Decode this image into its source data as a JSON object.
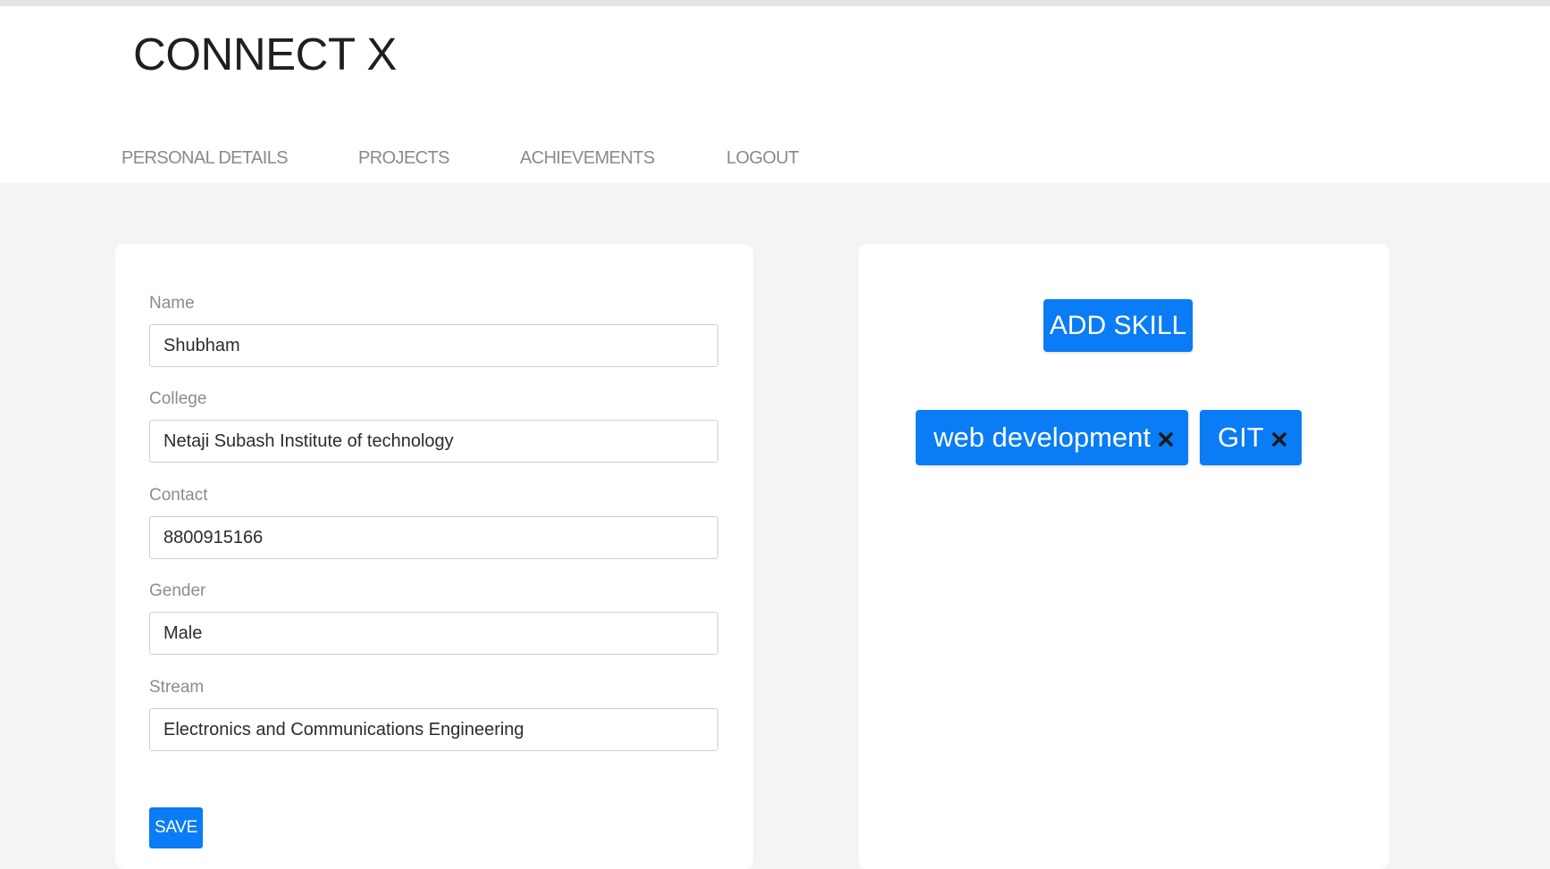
{
  "app": {
    "title": "CONNECT X"
  },
  "nav": {
    "items": [
      {
        "label": "PERSONAL DETAILS"
      },
      {
        "label": "PROJECTS"
      },
      {
        "label": "ACHIEVEMENTS"
      },
      {
        "label": "LOGOUT"
      }
    ]
  },
  "form": {
    "fields": [
      {
        "label": "Name",
        "value": "Shubham"
      },
      {
        "label": "College",
        "value": "Netaji Subash Institute of technology"
      },
      {
        "label": "Contact",
        "value": "8800915166"
      },
      {
        "label": "Gender",
        "value": "Male"
      },
      {
        "label": "Stream",
        "value": "Electronics and Communications Engineering"
      }
    ],
    "save_label": "SAVE"
  },
  "skills": {
    "add_label": "ADD SKILL",
    "items": [
      {
        "label": "web development",
        "remove_icon": "close-icon"
      },
      {
        "label": "GIT",
        "remove_icon": "close-icon"
      }
    ]
  },
  "colors": {
    "accent": "#0a7cf5",
    "page_bg": "#f4f4f4",
    "nav_text": "#8a8a8a"
  }
}
